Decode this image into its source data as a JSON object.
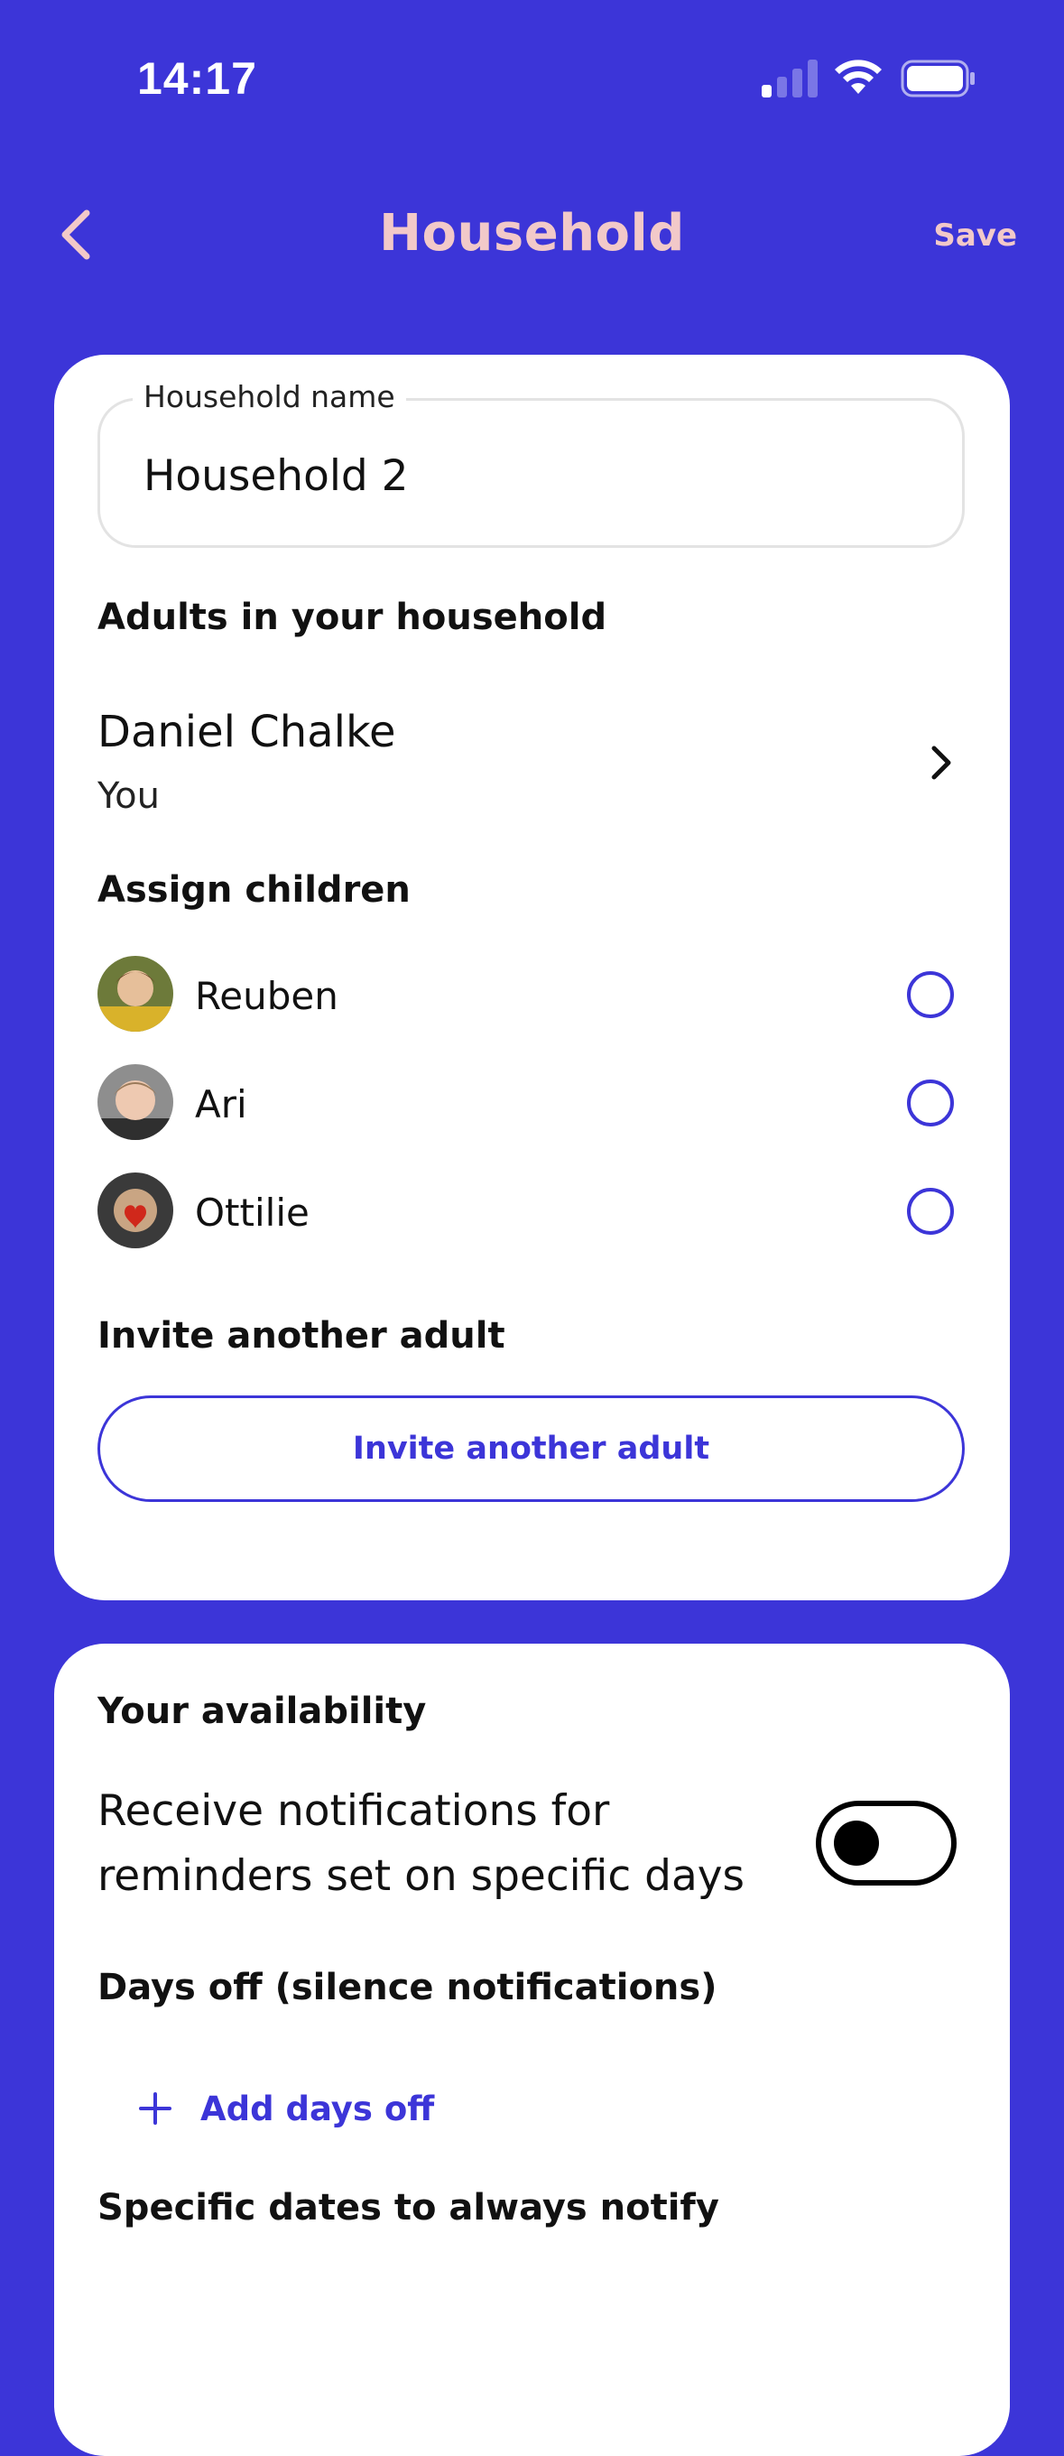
{
  "status_bar": {
    "time": "14:17",
    "signal_icon": "cellular-signal-icon",
    "wifi_icon": "wifi-icon",
    "battery_icon": "battery-icon"
  },
  "nav": {
    "back_icon": "chevron-left-icon",
    "title": "Household",
    "save_label": "Save"
  },
  "household_card": {
    "name_field_label": "Household name",
    "name_field_value": "Household 2",
    "adults_heading": "Adults in your household",
    "adults": [
      {
        "name": "Daniel Chalke",
        "subtitle": "You"
      }
    ],
    "assign_children_heading": "Assign children",
    "children": [
      {
        "name": "Reuben",
        "selected": false
      },
      {
        "name": "Ari",
        "selected": false
      },
      {
        "name": "Ottilie",
        "selected": false
      }
    ],
    "invite_heading": "Invite another adult",
    "invite_button_label": "Invite another adult"
  },
  "availability_card": {
    "heading": "Your availability",
    "notifications_label": "Receive notifications for reminders set on specific days",
    "notifications_enabled": false,
    "days_off_heading": "Days off (silence notifications)",
    "add_days_off_label": "Add days off",
    "specific_dates_heading": "Specific dates to always notify"
  },
  "colors": {
    "background": "#3c35d8",
    "accent": "#3c35d8",
    "nav_text": "#f2c9c9",
    "card": "#ffffff"
  }
}
